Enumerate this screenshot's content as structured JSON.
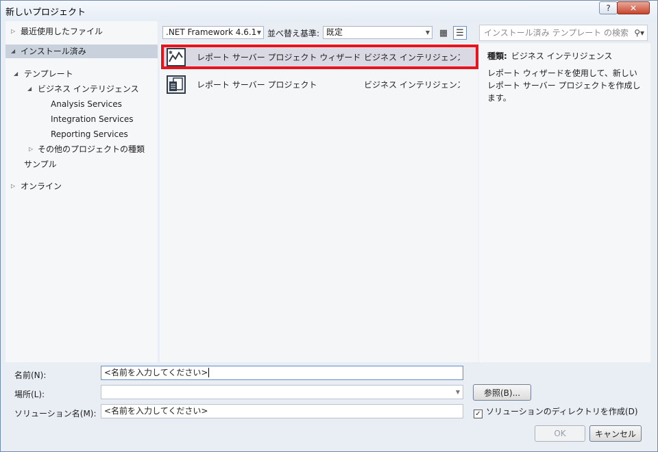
{
  "window": {
    "title": "新しいプロジェクト",
    "help": "?",
    "close": "✕"
  },
  "tree": {
    "recent": "最近使用したファイル",
    "installed": "インストール済み",
    "templates": "テンプレート",
    "bi": "ビジネス インテリジェンス",
    "analysis": "Analysis Services",
    "integration": "Integration Services",
    "reporting": "Reporting Services",
    "other": "その他のプロジェクトの種類",
    "samples": "サンプル",
    "online": "オンライン"
  },
  "toolbar": {
    "framework": ".NET Framework 4.6.1",
    "sort_label": "並べ替え基準:",
    "sort_value": "既定"
  },
  "search": {
    "placeholder": "インストール済み テンプレート の検索"
  },
  "templates": [
    {
      "name": "レポート サーバー プロジェクト ウィザード",
      "type": "ビジネス インテリジェンス",
      "icon": "report-wizard-icon"
    },
    {
      "name": "レポート サーバー プロジェクト",
      "type": "ビジネス インテリジェンス",
      "icon": "report-project-icon"
    }
  ],
  "details": {
    "type_label": "種類:",
    "type_value": "ビジネス インテリジェンス",
    "description": "レポート ウィザードを使用して、新しいレポート サーバー プロジェクトを作成します。"
  },
  "form": {
    "name_label": "名前(N):",
    "name_value": "<名前を入力してください>",
    "location_label": "場所(L):",
    "location_value": "",
    "solution_label": "ソリューション名(M):",
    "solution_value": "<名前を入力してください>",
    "browse": "参照(B)...",
    "create_dir": "ソリューションのディレクトリを作成(D)",
    "create_dir_checked": true,
    "ok": "OK",
    "cancel": "キャンセル"
  },
  "colors": {
    "highlight": "#e8131c",
    "selection": "#c9d2dc"
  }
}
